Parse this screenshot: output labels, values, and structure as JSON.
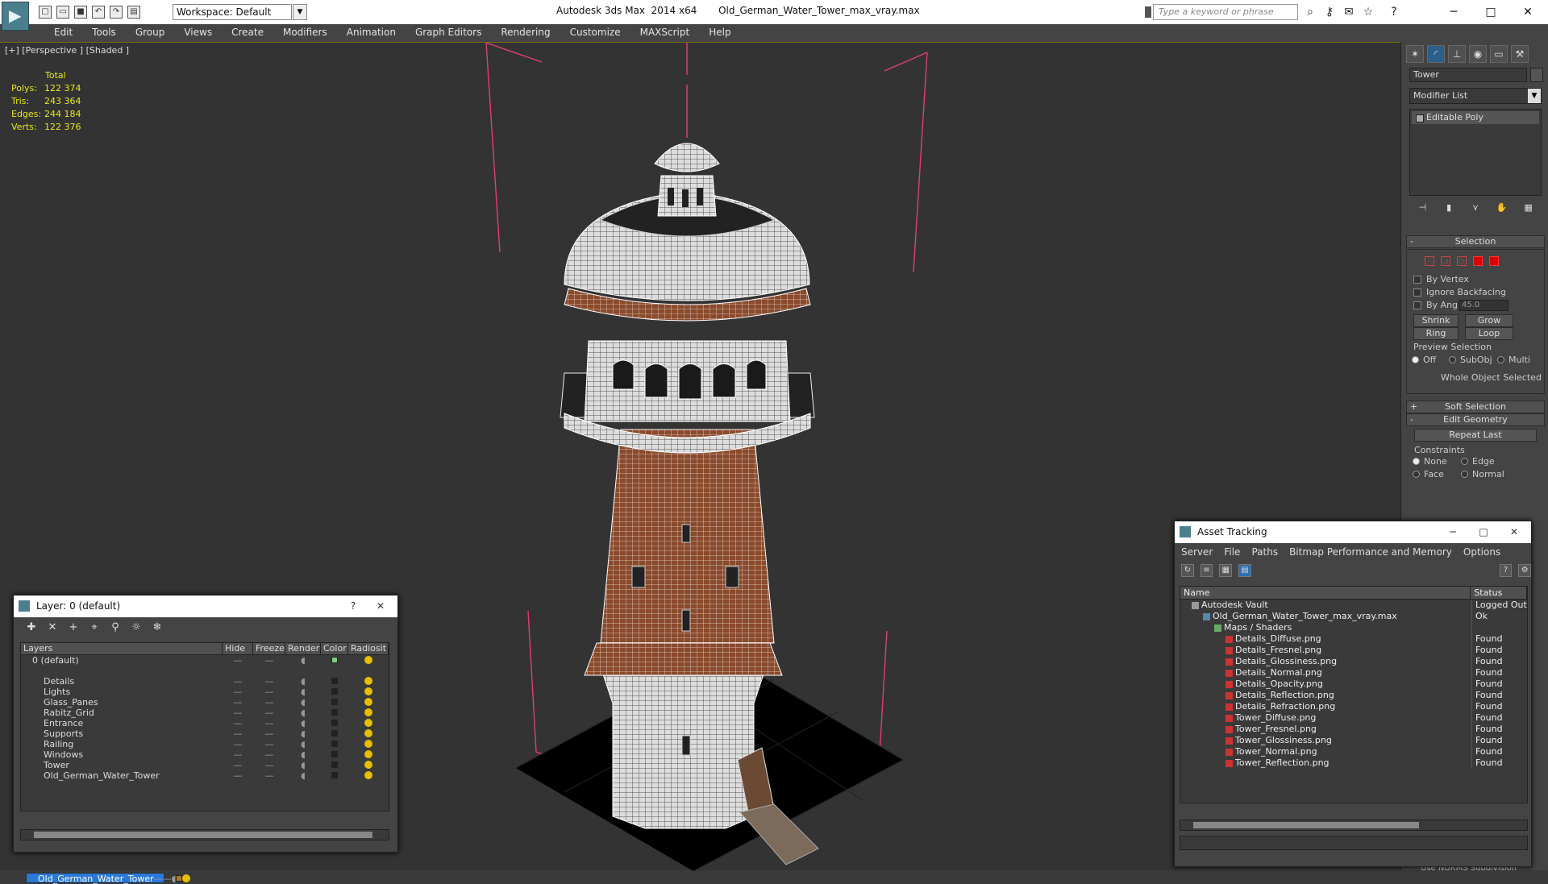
{
  "app": {
    "title": "Autodesk 3ds Max  2014 x64",
    "file": "Old_German_Water_Tower_max_vray.max",
    "workspace": "Workspace: Default",
    "search_placeholder": "Type a keyword or phrase"
  },
  "menu": [
    "Edit",
    "Tools",
    "Group",
    "Views",
    "Create",
    "Modifiers",
    "Animation",
    "Graph Editors",
    "Rendering",
    "Customize",
    "MAXScript",
    "Help"
  ],
  "viewport": {
    "label": "[+] [Perspective ] [Shaded ]",
    "stats": {
      "header": "Total",
      "rows": [
        {
          "k": "Polys:",
          "v": "122 374"
        },
        {
          "k": "Tris:",
          "v": "243 364"
        },
        {
          "k": "Edges:",
          "v": "244 184"
        },
        {
          "k": "Verts:",
          "v": "122 376"
        }
      ]
    }
  },
  "command_panel": {
    "object_name": "Tower",
    "modifier_list": "Modifier List",
    "stack_item": "Editable Poly",
    "selection": {
      "title": "Selection",
      "by_vertex": "By Vertex",
      "ignore_backfacing": "Ignore Backfacing",
      "by_angle": "By Angle:",
      "angle_value": "45.0",
      "shrink": "Shrink",
      "grow": "Grow",
      "ring": "Ring",
      "loop": "Loop",
      "preview_selection": "Preview Selection",
      "off": "Off",
      "subobj": "SubObj",
      "multi": "Multi",
      "whole_object": "Whole Object Selected"
    },
    "soft_selection": "Soft Selection",
    "edit_geometry": "Edit Geometry",
    "repeat_last": "Repeat Last",
    "constraints": "Constraints",
    "c_none": "None",
    "c_edge": "Edge",
    "c_face": "Face",
    "c_normal": "Normal",
    "nurms": "Use NURMS Subdivision"
  },
  "layer_window": {
    "title": "Layer: 0 (default)",
    "help": "?",
    "columns": [
      "Layers",
      "Hide",
      "Freeze",
      "Render",
      "Color",
      "Radiosit"
    ],
    "rows": [
      {
        "name": "0 (default)",
        "indent": 1,
        "color": "#7fd07f",
        "selected": false
      },
      {
        "name": "Old_German_Water_Tower",
        "indent": 1,
        "color": "#b07a20",
        "selected": true
      },
      {
        "name": "Details",
        "indent": 2,
        "color": "#222222",
        "selected": false
      },
      {
        "name": "Lights",
        "indent": 2,
        "color": "#222222",
        "selected": false
      },
      {
        "name": "Glass_Panes",
        "indent": 2,
        "color": "#222222",
        "selected": false
      },
      {
        "name": "Rabitz_Grid",
        "indent": 2,
        "color": "#222222",
        "selected": false
      },
      {
        "name": "Entrance",
        "indent": 2,
        "color": "#222222",
        "selected": false
      },
      {
        "name": "Supports",
        "indent": 2,
        "color": "#222222",
        "selected": false
      },
      {
        "name": "Railing",
        "indent": 2,
        "color": "#222222",
        "selected": false
      },
      {
        "name": "Windows",
        "indent": 2,
        "color": "#222222",
        "selected": false
      },
      {
        "name": "Tower",
        "indent": 2,
        "color": "#222222",
        "selected": false
      },
      {
        "name": "Old_German_Water_Tower",
        "indent": 2,
        "color": "#222222",
        "selected": false
      }
    ]
  },
  "asset_window": {
    "title": "Asset Tracking",
    "menu": [
      "Server",
      "File",
      "Paths",
      "Bitmap Performance and Memory",
      "Options"
    ],
    "columns": [
      "Name",
      "Status"
    ],
    "rows": [
      {
        "name": "Autodesk Vault",
        "status": "Logged Out",
        "indent": 1,
        "kind": "v"
      },
      {
        "name": "Old_German_Water_Tower_max_vray.max",
        "status": "Ok",
        "indent": 2,
        "kind": "ok"
      },
      {
        "name": "Maps / Shaders",
        "status": "",
        "indent": 3,
        "kind": "fld"
      },
      {
        "name": "Details_Diffuse.png",
        "status": "Found",
        "indent": 4,
        "kind": "png"
      },
      {
        "name": "Details_Fresnel.png",
        "status": "Found",
        "indent": 4,
        "kind": "png"
      },
      {
        "name": "Details_Glossiness.png",
        "status": "Found",
        "indent": 4,
        "kind": "png"
      },
      {
        "name": "Details_Normal.png",
        "status": "Found",
        "indent": 4,
        "kind": "png"
      },
      {
        "name": "Details_Opacity.png",
        "status": "Found",
        "indent": 4,
        "kind": "png"
      },
      {
        "name": "Details_Reflection.png",
        "status": "Found",
        "indent": 4,
        "kind": "png"
      },
      {
        "name": "Details_Refraction.png",
        "status": "Found",
        "indent": 4,
        "kind": "png"
      },
      {
        "name": "Tower_Diffuse.png",
        "status": "Found",
        "indent": 4,
        "kind": "png"
      },
      {
        "name": "Tower_Fresnel.png",
        "status": "Found",
        "indent": 4,
        "kind": "png"
      },
      {
        "name": "Tower_Glossiness.png",
        "status": "Found",
        "indent": 4,
        "kind": "png"
      },
      {
        "name": "Tower_Normal.png",
        "status": "Found",
        "indent": 4,
        "kind": "png"
      },
      {
        "name": "Tower_Reflection.png",
        "status": "Found",
        "indent": 4,
        "kind": "png"
      }
    ]
  },
  "colors": {
    "accent": "#2979d8",
    "stats": "#e8e81a",
    "brick": "#8a4a2c",
    "bbox": "#e04070"
  }
}
